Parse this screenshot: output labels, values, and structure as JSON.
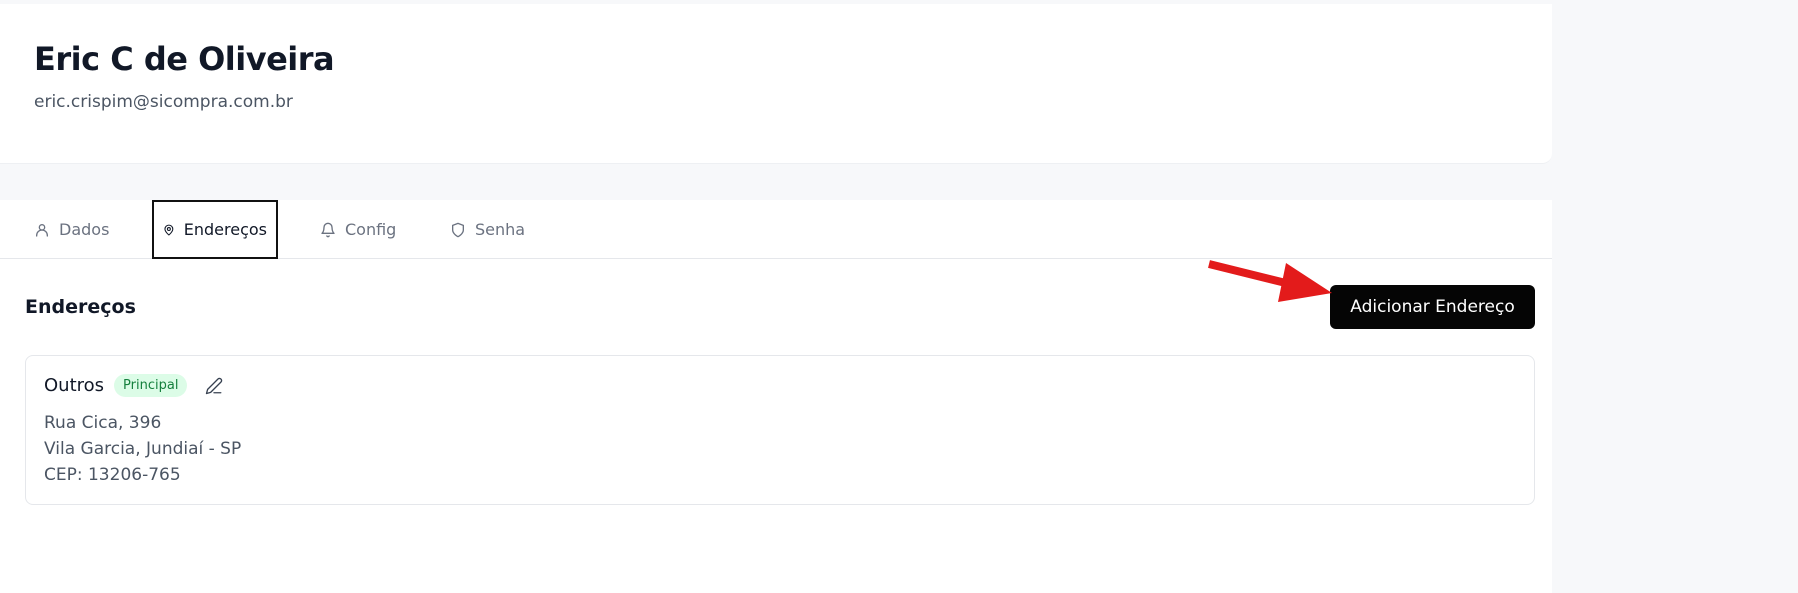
{
  "profile": {
    "name": "Eric C de Oliveira",
    "email": "eric.crispim@sicompra.com.br"
  },
  "tabs": [
    {
      "label": "Dados",
      "icon": "user-icon",
      "active": false
    },
    {
      "label": "Endereços",
      "icon": "map-pin-icon",
      "active": true
    },
    {
      "label": "Config",
      "icon": "bell-icon",
      "active": false
    },
    {
      "label": "Senha",
      "icon": "shield-icon",
      "active": false
    }
  ],
  "section": {
    "title": "Endereços",
    "add_button_label": "Adicionar Endereço"
  },
  "addresses": [
    {
      "label": "Outros",
      "badge": "Principal",
      "street": "Rua Cica, 396",
      "district_city": "Vila Garcia, Jundiaí - SP",
      "cep": "CEP: 13206-765"
    }
  ],
  "colors": {
    "accent": "#050505",
    "badge_bg": "#dcfce7",
    "badge_text": "#15803d",
    "annotation_arrow": "#e31b1b"
  }
}
